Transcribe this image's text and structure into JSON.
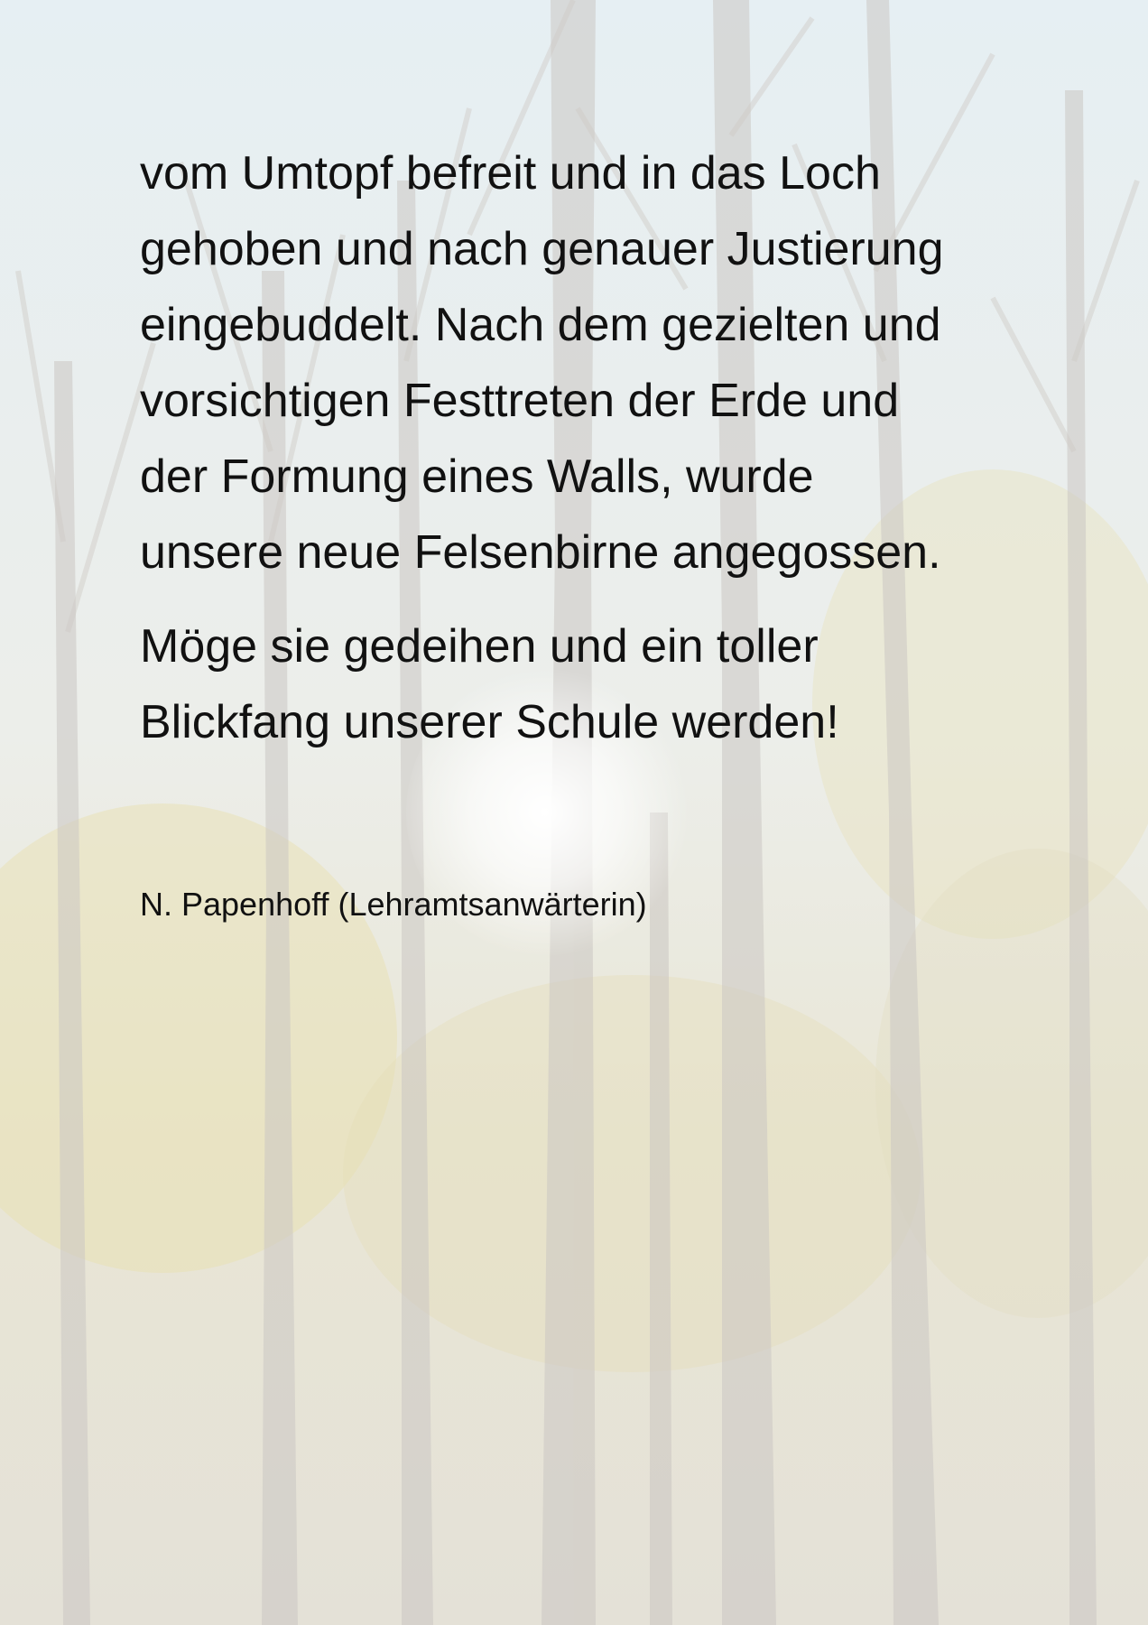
{
  "document": {
    "paragraphs": [
      {
        "lines": [
          "vom Umtopf befreit und in das Loch",
          "gehoben und nach genauer Justierung",
          "eingebuddelt. Nach dem gezielten und",
          "vorsichtigen Festtreten der Erde und",
          "der Formung eines Walls, wurde",
          "unsere neue Felsenbirne angegossen."
        ]
      },
      {
        "lines": [
          "Möge sie gedeihen und ein toller",
          "Blickfang unserer Schule werden!"
        ]
      }
    ],
    "signature": "N. Papenhoff (Lehramtsanwärterin)"
  },
  "background": {
    "description_icon": "forest-sunlight-watermark",
    "sky_color": "#e9f2f6",
    "tree_color": "#c9c3bd",
    "foliage_color": "#e8dca0",
    "sun_color": "#ffffff"
  }
}
